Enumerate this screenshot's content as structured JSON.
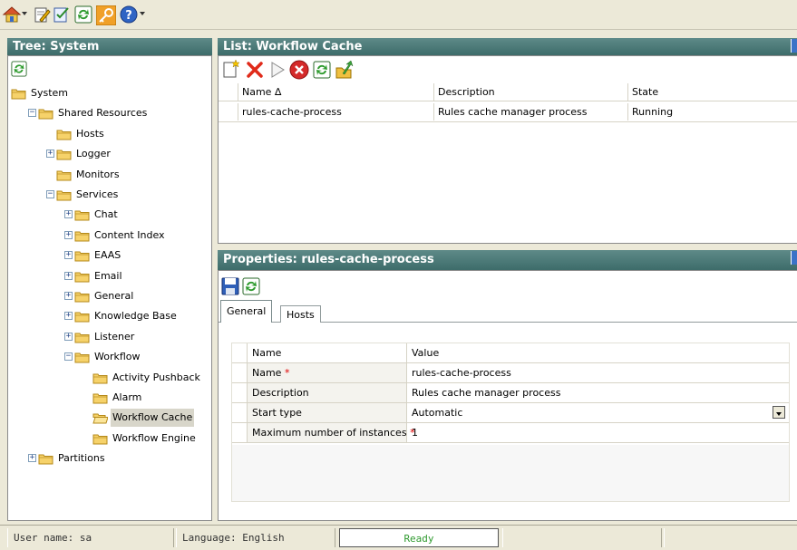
{
  "toolbar": {
    "icons": [
      "home-icon",
      "edit-icon",
      "checklist-icon",
      "refresh-icon",
      "key-icon",
      "help-icon"
    ]
  },
  "tree_panel": {
    "title": "Tree: System",
    "items": [
      {
        "label": "System",
        "level": 0,
        "expander": ""
      },
      {
        "label": "Shared Resources",
        "level": 1,
        "expander": "−"
      },
      {
        "label": "Hosts",
        "level": 2,
        "expander": ""
      },
      {
        "label": "Logger",
        "level": 2,
        "expander": "+"
      },
      {
        "label": "Monitors",
        "level": 2,
        "expander": ""
      },
      {
        "label": "Services",
        "level": 2,
        "expander": "−"
      },
      {
        "label": "Chat",
        "level": 3,
        "expander": "+"
      },
      {
        "label": "Content Index",
        "level": 3,
        "expander": "+"
      },
      {
        "label": "EAAS",
        "level": 3,
        "expander": "+"
      },
      {
        "label": "Email",
        "level": 3,
        "expander": "+"
      },
      {
        "label": "General",
        "level": 3,
        "expander": "+"
      },
      {
        "label": "Knowledge Base",
        "level": 3,
        "expander": "+"
      },
      {
        "label": "Listener",
        "level": 3,
        "expander": "+"
      },
      {
        "label": "Workflow",
        "level": 3,
        "expander": "−"
      },
      {
        "label": "Activity Pushback",
        "level": 4,
        "expander": ""
      },
      {
        "label": "Alarm",
        "level": 4,
        "expander": ""
      },
      {
        "label": "Workflow Cache",
        "level": 4,
        "expander": "",
        "selected": true
      },
      {
        "label": "Workflow Engine",
        "level": 4,
        "expander": ""
      },
      {
        "label": "Partitions",
        "level": 1,
        "expander": "+"
      }
    ]
  },
  "list_panel": {
    "title": "List: Workflow Cache",
    "columns": [
      "Name ∆",
      "Description",
      "State"
    ],
    "rows": [
      [
        "rules-cache-process",
        "Rules cache manager process",
        "Running"
      ]
    ]
  },
  "properties_panel": {
    "title": "Properties: rules-cache-process",
    "tabs": [
      "General",
      "Hosts"
    ],
    "columns": [
      "Name",
      "Value"
    ],
    "rows": [
      {
        "name": "Name",
        "required": "*",
        "value": "rules-cache-process"
      },
      {
        "name": "Description",
        "required": "",
        "value": "Rules cache manager process"
      },
      {
        "name": "Start type",
        "required": "",
        "value": "Automatic"
      },
      {
        "name": "Maximum number of instances",
        "required": "*",
        "value": "1"
      }
    ]
  },
  "status_bar": {
    "user": "User name: sa",
    "language": "Language: English",
    "status": "Ready"
  },
  "colors": {
    "panel_header": "#3d6c6a",
    "ready_text": "#2f9a2f",
    "required": "#e00000"
  }
}
